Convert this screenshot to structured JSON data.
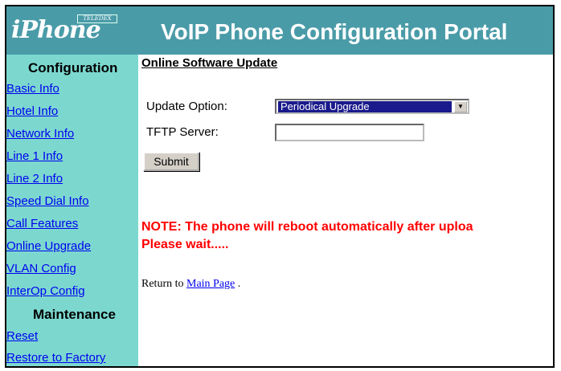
{
  "header": {
    "logo_text": "iPhone",
    "logo_badge": "TELEDEX",
    "title": "VoIP Phone Configuration Portal"
  },
  "sidebar": {
    "config_heading": "Configuration",
    "config_items": [
      {
        "label": "Basic Info"
      },
      {
        "label": "Hotel Info"
      },
      {
        "label": "Network Info"
      },
      {
        "label": "Line 1 Info"
      },
      {
        "label": "Line 2 Info"
      },
      {
        "label": "Speed Dial Info"
      },
      {
        "label": "Call Features"
      },
      {
        "label": "Online Upgrade"
      },
      {
        "label": "VLAN Config"
      },
      {
        "label": "InterOp Config"
      }
    ],
    "maintenance_heading": "Maintenance",
    "maintenance_items": [
      {
        "label": "Reset"
      },
      {
        "label": "Restore to Factory"
      }
    ]
  },
  "main": {
    "title": "Online Software Update",
    "update_option_label": "Update Option:",
    "update_option_value": "Periodical Upgrade",
    "tftp_label": "TFTP Server:",
    "tftp_value": "",
    "submit_label": "Submit",
    "note_line1": "NOTE: The phone will reboot automatically after uploa",
    "note_line2": "Please wait.....",
    "return_prefix": "Return to",
    "return_link": "Main Page",
    "return_suffix": "."
  },
  "colors": {
    "header_bg": "#4a9ba8",
    "sidebar_bg": "#7cd8cf",
    "link": "#0000ee",
    "note": "#ff0000",
    "select_highlight": "#1a1a8c"
  }
}
